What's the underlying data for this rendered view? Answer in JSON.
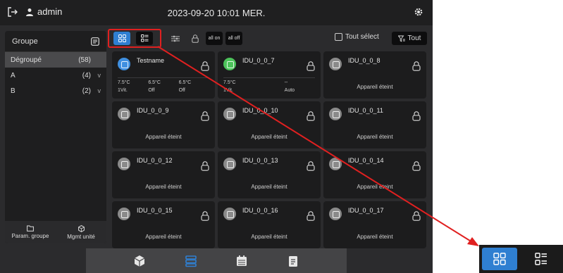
{
  "topbar": {
    "user": "admin",
    "datetime": "2023-09-20 10:01 MER."
  },
  "sidebar": {
    "header": "Groupe",
    "items": [
      {
        "label": "Dégroupé",
        "count": "(58)",
        "expand": ""
      },
      {
        "label": "A",
        "count": "(4)",
        "expand": "v"
      },
      {
        "label": "B",
        "count": "(2)",
        "expand": "v"
      }
    ],
    "footer": {
      "group_params": "Param. groupe",
      "unit_mgmt": "Mgmt unité"
    }
  },
  "toolbar": {
    "view_grid_icon": "grid-view-icon",
    "view_list_icon": "list-view-icon",
    "all_on": "all on",
    "all_off": "all off",
    "select_all": "Tout sélect",
    "filter_all": "Tout"
  },
  "devices": [
    {
      "name": "Testname",
      "icon_color": "#3f8fe0",
      "status": "",
      "details": {
        "row1": [
          "7.5°C",
          "6.5°C",
          "6.5°C"
        ],
        "row2": [
          "1Vit.",
          "Off",
          "Off"
        ]
      }
    },
    {
      "name": "IDU_0_0_7",
      "icon_color": "#4cc35a",
      "status": "",
      "details": {
        "row1": [
          "7.5°C",
          "",
          "--"
        ],
        "row2": [
          "1Vit.",
          "",
          "Auto"
        ]
      }
    },
    {
      "name": "IDU_0_0_8",
      "icon_color": "#8a8a8a",
      "status": "Appareil éteint"
    },
    {
      "name": "IDU_0_0_9",
      "icon_color": "#8a8a8a",
      "status": "Appareil éteint"
    },
    {
      "name": "IDU_0_0_10",
      "icon_color": "#8a8a8a",
      "status": "Appareil éteint"
    },
    {
      "name": "IDU_0_0_11",
      "icon_color": "#8a8a8a",
      "status": "Appareil éteint"
    },
    {
      "name": "IDU_0_0_12",
      "icon_color": "#8a8a8a",
      "status": "Appareil éteint"
    },
    {
      "name": "IDU_0_0_13",
      "icon_color": "#8a8a8a",
      "status": "Appareil éteint"
    },
    {
      "name": "IDU_0_0_14",
      "icon_color": "#8a8a8a",
      "status": "Appareil éteint"
    },
    {
      "name": "IDU_0_0_15",
      "icon_color": "#8a8a8a",
      "status": "Appareil éteint"
    },
    {
      "name": "IDU_0_0_16",
      "icon_color": "#8a8a8a",
      "status": "Appareil éteint"
    },
    {
      "name": "IDU_0_0_17",
      "icon_color": "#8a8a8a",
      "status": "Appareil éteint"
    }
  ],
  "bottomnav": [
    "cube-icon",
    "layers-icon",
    "calendar-icon",
    "clipboard-icon"
  ],
  "colors": {
    "accent": "#2f7fd1",
    "annotation": "#e02020"
  }
}
